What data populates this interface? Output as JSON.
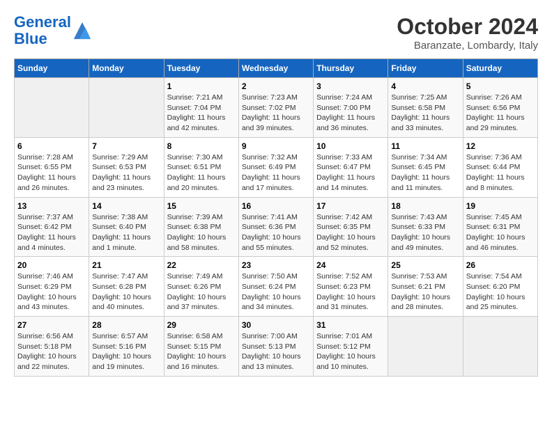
{
  "header": {
    "logo_line1": "General",
    "logo_line2": "Blue",
    "month_title": "October 2024",
    "subtitle": "Baranzate, Lombardy, Italy"
  },
  "days_of_week": [
    "Sunday",
    "Monday",
    "Tuesday",
    "Wednesday",
    "Thursday",
    "Friday",
    "Saturday"
  ],
  "weeks": [
    [
      {
        "day": "",
        "sunrise": "",
        "sunset": "",
        "daylight": ""
      },
      {
        "day": "",
        "sunrise": "",
        "sunset": "",
        "daylight": ""
      },
      {
        "day": "1",
        "sunrise": "Sunrise: 7:21 AM",
        "sunset": "Sunset: 7:04 PM",
        "daylight": "Daylight: 11 hours and 42 minutes."
      },
      {
        "day": "2",
        "sunrise": "Sunrise: 7:23 AM",
        "sunset": "Sunset: 7:02 PM",
        "daylight": "Daylight: 11 hours and 39 minutes."
      },
      {
        "day": "3",
        "sunrise": "Sunrise: 7:24 AM",
        "sunset": "Sunset: 7:00 PM",
        "daylight": "Daylight: 11 hours and 36 minutes."
      },
      {
        "day": "4",
        "sunrise": "Sunrise: 7:25 AM",
        "sunset": "Sunset: 6:58 PM",
        "daylight": "Daylight: 11 hours and 33 minutes."
      },
      {
        "day": "5",
        "sunrise": "Sunrise: 7:26 AM",
        "sunset": "Sunset: 6:56 PM",
        "daylight": "Daylight: 11 hours and 29 minutes."
      }
    ],
    [
      {
        "day": "6",
        "sunrise": "Sunrise: 7:28 AM",
        "sunset": "Sunset: 6:55 PM",
        "daylight": "Daylight: 11 hours and 26 minutes."
      },
      {
        "day": "7",
        "sunrise": "Sunrise: 7:29 AM",
        "sunset": "Sunset: 6:53 PM",
        "daylight": "Daylight: 11 hours and 23 minutes."
      },
      {
        "day": "8",
        "sunrise": "Sunrise: 7:30 AM",
        "sunset": "Sunset: 6:51 PM",
        "daylight": "Daylight: 11 hours and 20 minutes."
      },
      {
        "day": "9",
        "sunrise": "Sunrise: 7:32 AM",
        "sunset": "Sunset: 6:49 PM",
        "daylight": "Daylight: 11 hours and 17 minutes."
      },
      {
        "day": "10",
        "sunrise": "Sunrise: 7:33 AM",
        "sunset": "Sunset: 6:47 PM",
        "daylight": "Daylight: 11 hours and 14 minutes."
      },
      {
        "day": "11",
        "sunrise": "Sunrise: 7:34 AM",
        "sunset": "Sunset: 6:45 PM",
        "daylight": "Daylight: 11 hours and 11 minutes."
      },
      {
        "day": "12",
        "sunrise": "Sunrise: 7:36 AM",
        "sunset": "Sunset: 6:44 PM",
        "daylight": "Daylight: 11 hours and 8 minutes."
      }
    ],
    [
      {
        "day": "13",
        "sunrise": "Sunrise: 7:37 AM",
        "sunset": "Sunset: 6:42 PM",
        "daylight": "Daylight: 11 hours and 4 minutes."
      },
      {
        "day": "14",
        "sunrise": "Sunrise: 7:38 AM",
        "sunset": "Sunset: 6:40 PM",
        "daylight": "Daylight: 11 hours and 1 minute."
      },
      {
        "day": "15",
        "sunrise": "Sunrise: 7:39 AM",
        "sunset": "Sunset: 6:38 PM",
        "daylight": "Daylight: 10 hours and 58 minutes."
      },
      {
        "day": "16",
        "sunrise": "Sunrise: 7:41 AM",
        "sunset": "Sunset: 6:36 PM",
        "daylight": "Daylight: 10 hours and 55 minutes."
      },
      {
        "day": "17",
        "sunrise": "Sunrise: 7:42 AM",
        "sunset": "Sunset: 6:35 PM",
        "daylight": "Daylight: 10 hours and 52 minutes."
      },
      {
        "day": "18",
        "sunrise": "Sunrise: 7:43 AM",
        "sunset": "Sunset: 6:33 PM",
        "daylight": "Daylight: 10 hours and 49 minutes."
      },
      {
        "day": "19",
        "sunrise": "Sunrise: 7:45 AM",
        "sunset": "Sunset: 6:31 PM",
        "daylight": "Daylight: 10 hours and 46 minutes."
      }
    ],
    [
      {
        "day": "20",
        "sunrise": "Sunrise: 7:46 AM",
        "sunset": "Sunset: 6:29 PM",
        "daylight": "Daylight: 10 hours and 43 minutes."
      },
      {
        "day": "21",
        "sunrise": "Sunrise: 7:47 AM",
        "sunset": "Sunset: 6:28 PM",
        "daylight": "Daylight: 10 hours and 40 minutes."
      },
      {
        "day": "22",
        "sunrise": "Sunrise: 7:49 AM",
        "sunset": "Sunset: 6:26 PM",
        "daylight": "Daylight: 10 hours and 37 minutes."
      },
      {
        "day": "23",
        "sunrise": "Sunrise: 7:50 AM",
        "sunset": "Sunset: 6:24 PM",
        "daylight": "Daylight: 10 hours and 34 minutes."
      },
      {
        "day": "24",
        "sunrise": "Sunrise: 7:52 AM",
        "sunset": "Sunset: 6:23 PM",
        "daylight": "Daylight: 10 hours and 31 minutes."
      },
      {
        "day": "25",
        "sunrise": "Sunrise: 7:53 AM",
        "sunset": "Sunset: 6:21 PM",
        "daylight": "Daylight: 10 hours and 28 minutes."
      },
      {
        "day": "26",
        "sunrise": "Sunrise: 7:54 AM",
        "sunset": "Sunset: 6:20 PM",
        "daylight": "Daylight: 10 hours and 25 minutes."
      }
    ],
    [
      {
        "day": "27",
        "sunrise": "Sunrise: 6:56 AM",
        "sunset": "Sunset: 5:18 PM",
        "daylight": "Daylight: 10 hours and 22 minutes."
      },
      {
        "day": "28",
        "sunrise": "Sunrise: 6:57 AM",
        "sunset": "Sunset: 5:16 PM",
        "daylight": "Daylight: 10 hours and 19 minutes."
      },
      {
        "day": "29",
        "sunrise": "Sunrise: 6:58 AM",
        "sunset": "Sunset: 5:15 PM",
        "daylight": "Daylight: 10 hours and 16 minutes."
      },
      {
        "day": "30",
        "sunrise": "Sunrise: 7:00 AM",
        "sunset": "Sunset: 5:13 PM",
        "daylight": "Daylight: 10 hours and 13 minutes."
      },
      {
        "day": "31",
        "sunrise": "Sunrise: 7:01 AM",
        "sunset": "Sunset: 5:12 PM",
        "daylight": "Daylight: 10 hours and 10 minutes."
      },
      {
        "day": "",
        "sunrise": "",
        "sunset": "",
        "daylight": ""
      },
      {
        "day": "",
        "sunrise": "",
        "sunset": "",
        "daylight": ""
      }
    ]
  ]
}
